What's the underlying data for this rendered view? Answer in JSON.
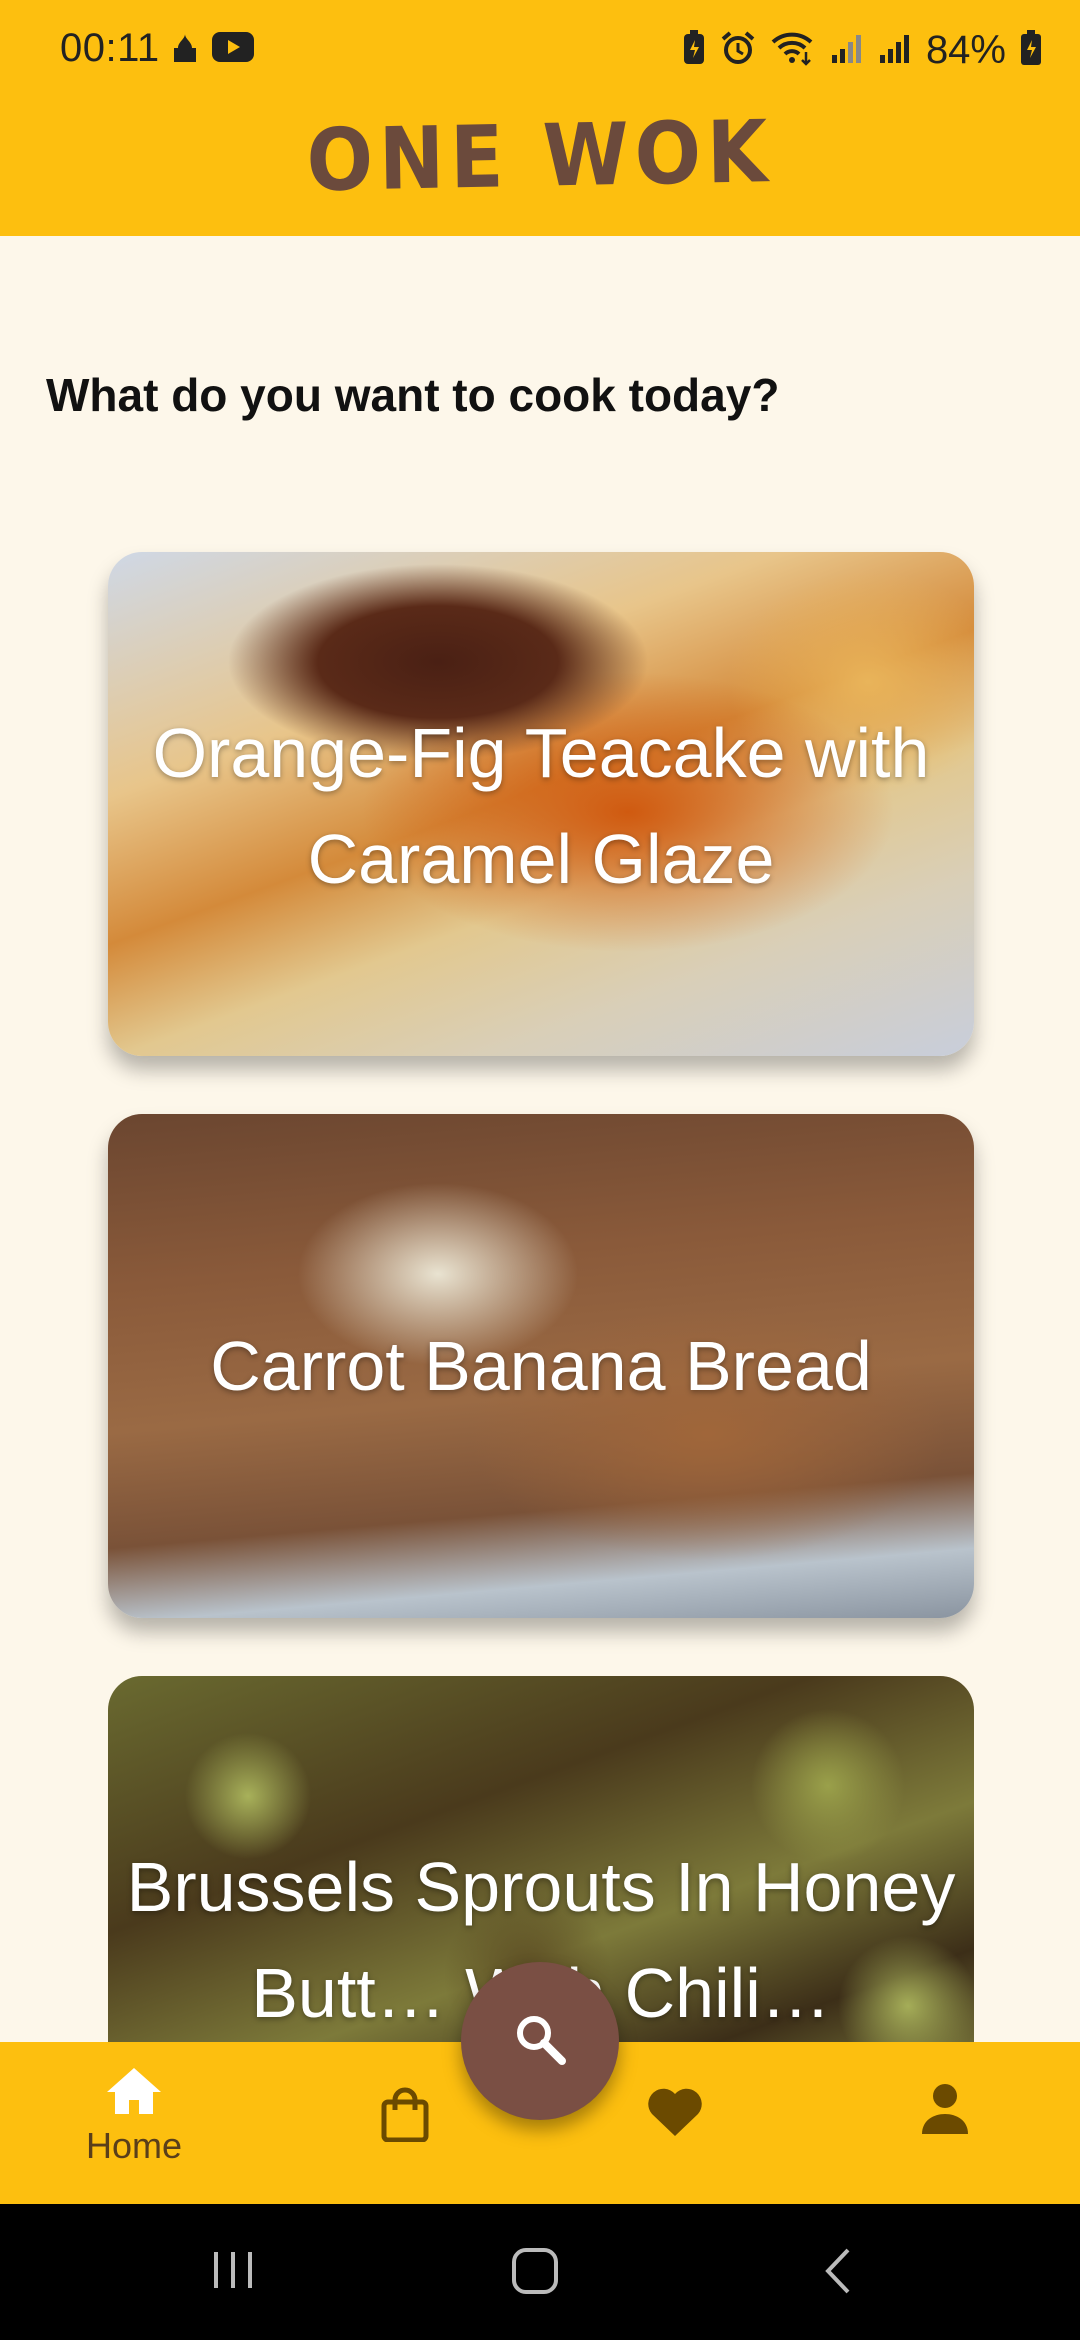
{
  "status_bar": {
    "time": "00:11",
    "battery_percent": "84%",
    "icons": [
      "mosque-icon",
      "youtube-icon",
      "battery-saver-icon",
      "alarm-icon",
      "wifi-icon",
      "signal-icon",
      "signal-icon",
      "battery-icon"
    ]
  },
  "app_bar": {
    "title": "ONE WOK"
  },
  "main": {
    "prompt": "What do you want to cook today?",
    "recipes": [
      {
        "title": "Orange-Fig Teacake with Caramel Glaze"
      },
      {
        "title": "Carrot Banana Bread"
      },
      {
        "title": "Brussels Sprouts In Honey Butt… With Chili…"
      }
    ]
  },
  "bottom_nav": {
    "items": [
      {
        "icon": "home-icon",
        "label": "Home",
        "selected": true
      },
      {
        "icon": "shopping-bag-icon",
        "label": ""
      },
      {
        "icon": "heart-icon",
        "label": ""
      },
      {
        "icon": "person-icon",
        "label": ""
      }
    ],
    "fab_icon": "search-icon"
  },
  "colors": {
    "accent": "#fdbf0f",
    "background": "#fdf7ea",
    "brand_brown": "#7a4f44",
    "nav_icon": "#6b4a00"
  }
}
